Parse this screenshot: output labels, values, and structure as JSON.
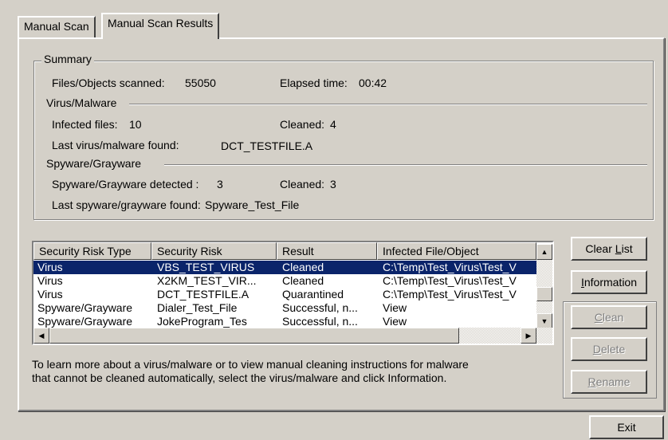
{
  "tabs": [
    {
      "label": "Manual Scan",
      "active": false
    },
    {
      "label": "Manual Scan Results",
      "active": true
    }
  ],
  "summary": {
    "legend": "Summary",
    "files_scanned_label": "Files/Objects scanned:",
    "files_scanned_value": "55050",
    "elapsed_label": "Elapsed time:",
    "elapsed_value": "00:42",
    "virus_section": "Virus/Malware",
    "infected_label": "Infected files:",
    "infected_value": "10",
    "virus_cleaned_label": "Cleaned:",
    "virus_cleaned_value": "4",
    "last_virus_label": "Last virus/malware found:",
    "last_virus_value": "DCT_TESTFILE.A",
    "spyware_section": "Spyware/Grayware",
    "spyware_detected_label": "Spyware/Grayware detected :",
    "spyware_detected_value": "3",
    "spyware_cleaned_label": "Cleaned:",
    "spyware_cleaned_value": "3",
    "last_spyware_label": "Last spyware/grayware found:",
    "last_spyware_value": "Spyware_Test_File"
  },
  "results_table": {
    "columns": [
      "Security Risk Type",
      "Security Risk",
      "Result",
      "Infected File/Object"
    ],
    "rows": [
      [
        "Virus",
        "VBS_TEST_VIRUS",
        "Cleaned",
        "C:\\Temp\\Test_Virus\\Test_V"
      ],
      [
        "Virus",
        "X2KM_TEST_VIR...",
        "Cleaned",
        "C:\\Temp\\Test_Virus\\Test_V"
      ],
      [
        "Virus",
        "DCT_TESTFILE.A",
        "Quarantined",
        "C:\\Temp\\Test_Virus\\Test_V"
      ],
      [
        "Spyware/Grayware",
        "Dialer_Test_File",
        "Successful, n...",
        "View"
      ],
      [
        "Spyware/Grayware",
        "JokeProgram_Tes",
        "Successful, n...",
        "View"
      ]
    ],
    "selected_row": 0
  },
  "info_text": {
    "line1": "To learn more about a virus/malware or to view manual cleaning instructions for malware",
    "line2": "that cannot be cleaned automatically, select the virus/malware and click Information."
  },
  "buttons": {
    "clear_list": {
      "pre": "Clear ",
      "mnemonic": "L",
      "post": "ist",
      "enabled": true
    },
    "information": {
      "pre": "",
      "mnemonic": "I",
      "post": "nformation",
      "enabled": true
    },
    "clean": {
      "pre": "",
      "mnemonic": "C",
      "post": "lean",
      "enabled": false
    },
    "delete": {
      "pre": "",
      "mnemonic": "D",
      "post": "elete",
      "enabled": false
    },
    "rename": {
      "pre": "",
      "mnemonic": "R",
      "post": "ename",
      "enabled": false
    },
    "exit": {
      "label": "Exit",
      "enabled": true
    }
  }
}
